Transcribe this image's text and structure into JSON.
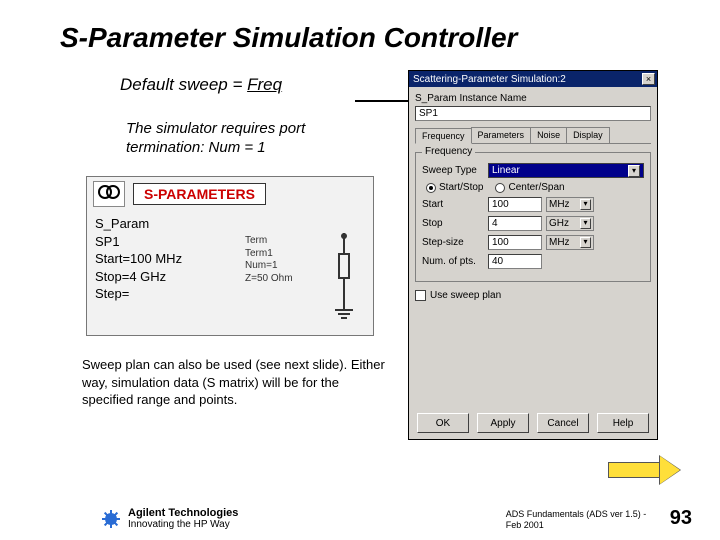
{
  "slide": {
    "title": "S-Parameter Simulation Controller",
    "subtitle_pre": "Default sweep = ",
    "subtitle_em": "Freq",
    "sim_note_l1": "The simulator requires port",
    "sim_note_l2": "termination:  Num = 1",
    "sweep_note": "Sweep plan can also be used (see next slide). Either way,  simulation data (S matrix) will be for the specified range and points."
  },
  "sparam": {
    "heading": "S-PARAMETERS",
    "lines": [
      "S_Param",
      "SP1",
      "Start=100 MHz",
      "Stop=4 GHz",
      "Step="
    ],
    "term": [
      "Term",
      "Term1",
      "Num=1",
      "Z=50 Ohm"
    ]
  },
  "dialog": {
    "title": "Scattering-Parameter Simulation:2",
    "instance_label": "S_Param Instance Name",
    "instance_value": "SP1",
    "tabs": [
      "Frequency",
      "Parameters",
      "Noise",
      "Display"
    ],
    "group_title": "Frequency",
    "sweep_type_label": "Sweep Type",
    "sweep_type_value": "Linear",
    "radio_start_stop": "Start/Stop",
    "radio_center_span": "Center/Span",
    "rows": {
      "start": {
        "label": "Start",
        "value": "100",
        "unit": "MHz"
      },
      "stop": {
        "label": "Stop",
        "value": "4",
        "unit": "GHz"
      },
      "step": {
        "label": "Step-size",
        "value": "100",
        "unit": "MHz"
      },
      "npts": {
        "label": "Num. of pts.",
        "value": "40"
      }
    },
    "use_sweep_plan": "Use sweep plan",
    "buttons": {
      "ok": "OK",
      "apply": "Apply",
      "cancel": "Cancel",
      "help": "Help"
    }
  },
  "footer": {
    "company": "Agilent Technologies",
    "tagline": "Innovating the HP Way",
    "mid": "ADS Fundamentals (ADS ver 1.5) - Feb 2001",
    "page": "93"
  }
}
